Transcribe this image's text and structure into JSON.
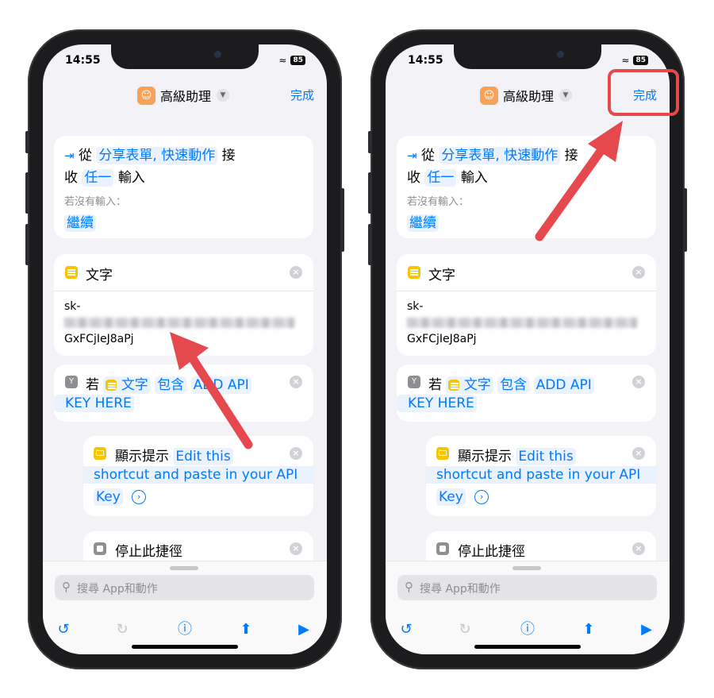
{
  "status": {
    "time": "14:55",
    "battery": "85"
  },
  "nav": {
    "title": "高級助理",
    "done": "完成"
  },
  "receive": {
    "from": "從",
    "sources": "分享表單, 快速動作",
    "receive_word": "接",
    "receive_word2": "收",
    "type": "任一",
    "input_word": "輸入",
    "no_input": "若沒有輸入：",
    "continue": "繼續"
  },
  "text_action": {
    "title": "文字",
    "line1": "sk-",
    "line3": "GxFCjIeJ8aPj"
  },
  "if_action": {
    "if": "若",
    "var": "文字",
    "cond": "包含",
    "val1": "ADD API",
    "val2": "KEY HERE"
  },
  "alert_action": {
    "title": "顯示提示",
    "msg1": "Edit this",
    "msg2": "shortcut and paste in your API",
    "msg3": "Key"
  },
  "stop_action": {
    "title": "停止此捷徑"
  },
  "search": {
    "placeholder": "搜尋 App和動作"
  },
  "colors": {
    "accent": "#007aff",
    "annotation": "#e5484d",
    "text_icon": "#f7c500",
    "app_icon": "#f6a25b"
  },
  "toolbar": {
    "undo_icon": "undo-icon",
    "redo_icon": "redo-icon",
    "info_icon": "info-icon",
    "share_icon": "share-icon",
    "play_icon": "play-icon"
  }
}
